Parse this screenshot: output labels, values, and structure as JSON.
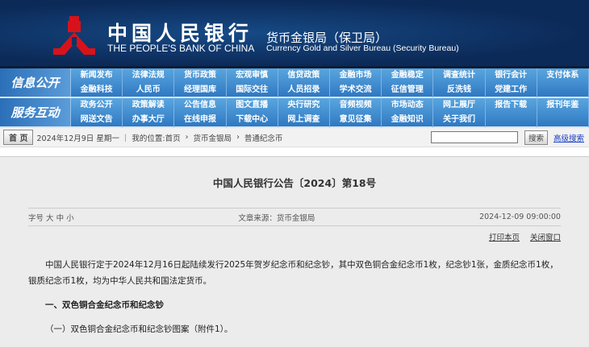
{
  "header": {
    "bank_cn": "中国人民银行",
    "bank_en": "THE PEOPLE'S BANK OF CHINA",
    "bureau_cn": "货币金银局（保卫局）",
    "bureau_en": "Currency  Gold and Silver Bureau (Security Bureau)"
  },
  "nav": [
    {
      "label": "信息公开",
      "items": [
        "新闻发布",
        "法律法规",
        "货币政策",
        "宏观审慎",
        "信贷政策",
        "金融市场",
        "金融稳定",
        "调查统计",
        "银行会计",
        "支付体系",
        "金融科技",
        "人民币",
        "经理国库",
        "国际交往",
        "人员招录",
        "学术交流",
        "征信管理",
        "反洗钱",
        "党建工作",
        ""
      ]
    },
    {
      "label": "服务互动",
      "items": [
        "政务公开",
        "政策解读",
        "公告信息",
        "图文直播",
        "央行研究",
        "音频视频",
        "市场动态",
        "网上展厅",
        "报告下载",
        "报刊年鉴",
        "网送文告",
        "办事大厅",
        "在线申报",
        "下载中心",
        "网上调查",
        "意见征集",
        "金融知识",
        "关于我们",
        "",
        ""
      ]
    }
  ],
  "breadcrumb": {
    "home": "首 页",
    "date": "2024年12月9日 星期一",
    "location": "｜ 我的位置:首页",
    "sep": "›",
    "c1": "货币金银局",
    "c2": "普通纪念币",
    "search_value": "",
    "search_button": "搜索",
    "advanced": "高级搜索"
  },
  "article": {
    "title": "中国人民银行公告〔2024〕第18号",
    "font_label": "字号",
    "font_large": "大",
    "font_medium": "中",
    "font_small": "小",
    "source": "文章来源：货币金银局",
    "datetime": "2024-12-09 09:00:00",
    "print": "打印本页",
    "close": "关闭窗口",
    "para1": "中国人民银行定于2024年12月16日起陆续发行2025年贺岁纪念币和纪念钞，其中双色铜合金纪念币1枚，纪念钞1张，金质纪念币1枚，银质纪念币1枚，均为中华人民共和国法定货币。",
    "heading1": "一、双色铜合金纪念币和纪念钞",
    "sub1": "（一）双色铜合金纪念币和纪念钞图案（附件1）。"
  }
}
